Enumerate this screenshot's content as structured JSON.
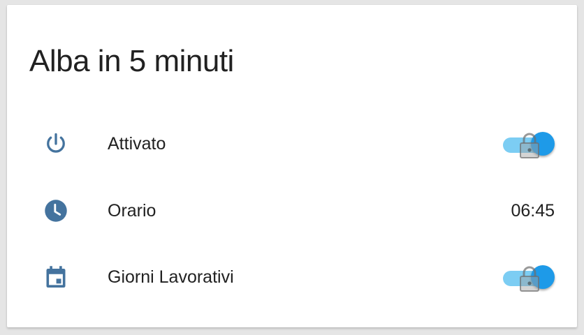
{
  "card": {
    "title": "Alba in 5 minuti"
  },
  "rows": [
    {
      "label": "Attivato",
      "icon": "power-icon",
      "control": "toggle",
      "state": "on"
    },
    {
      "label": "Orario",
      "icon": "clock-icon",
      "value": "06:45"
    },
    {
      "label": "Giorni Lavorativi",
      "icon": "calendar-icon",
      "control": "toggle",
      "state": "on"
    }
  ],
  "colors": {
    "icon": "#44739e",
    "toggle_thumb": "#1e9ae8",
    "toggle_track": "#7ccdf3",
    "text": "#212121"
  }
}
